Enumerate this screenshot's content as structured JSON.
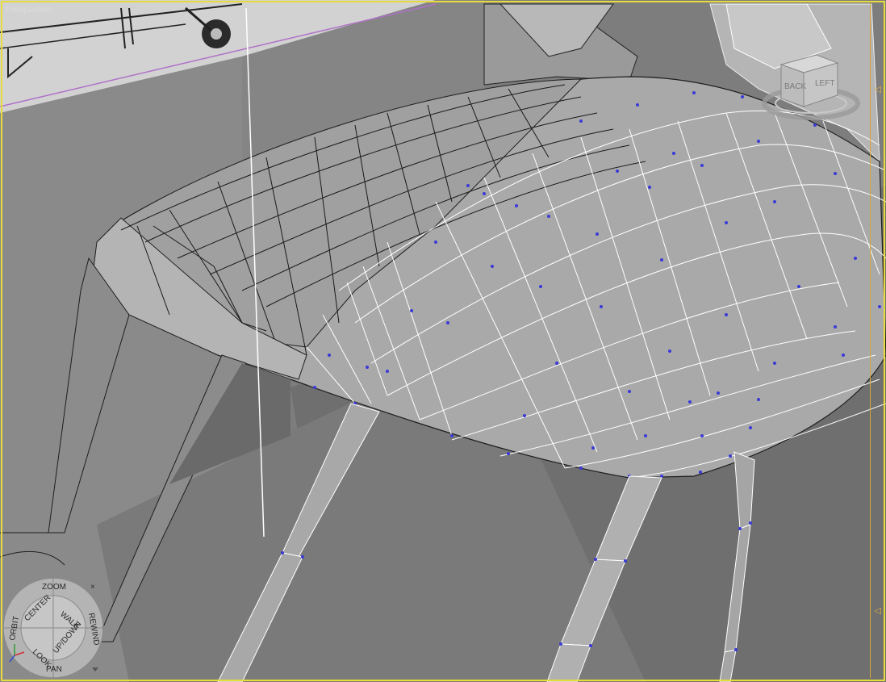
{
  "viewport": {
    "label": "Perspective",
    "colors": {
      "active_border": "#e8dc3a",
      "safe_frame": "#d4a63a",
      "vertex": "#3a3ad8",
      "wire": "#ffffff"
    }
  },
  "viewcube": {
    "faces": [
      "BACK",
      "LEFT"
    ]
  },
  "steering_wheel": {
    "zoom": "ZOOM",
    "orbit": "ORBIT",
    "center": "CENTER",
    "walk": "WALK",
    "rewind": "REWIND",
    "look": "LOOK",
    "updown": "UP/DOWN",
    "pan": "PAN",
    "close": "×"
  },
  "icons": [
    "axis-tripod-icon",
    "close-icon",
    "menu-arrow-icon",
    "safe-frame-marker-icon"
  ]
}
